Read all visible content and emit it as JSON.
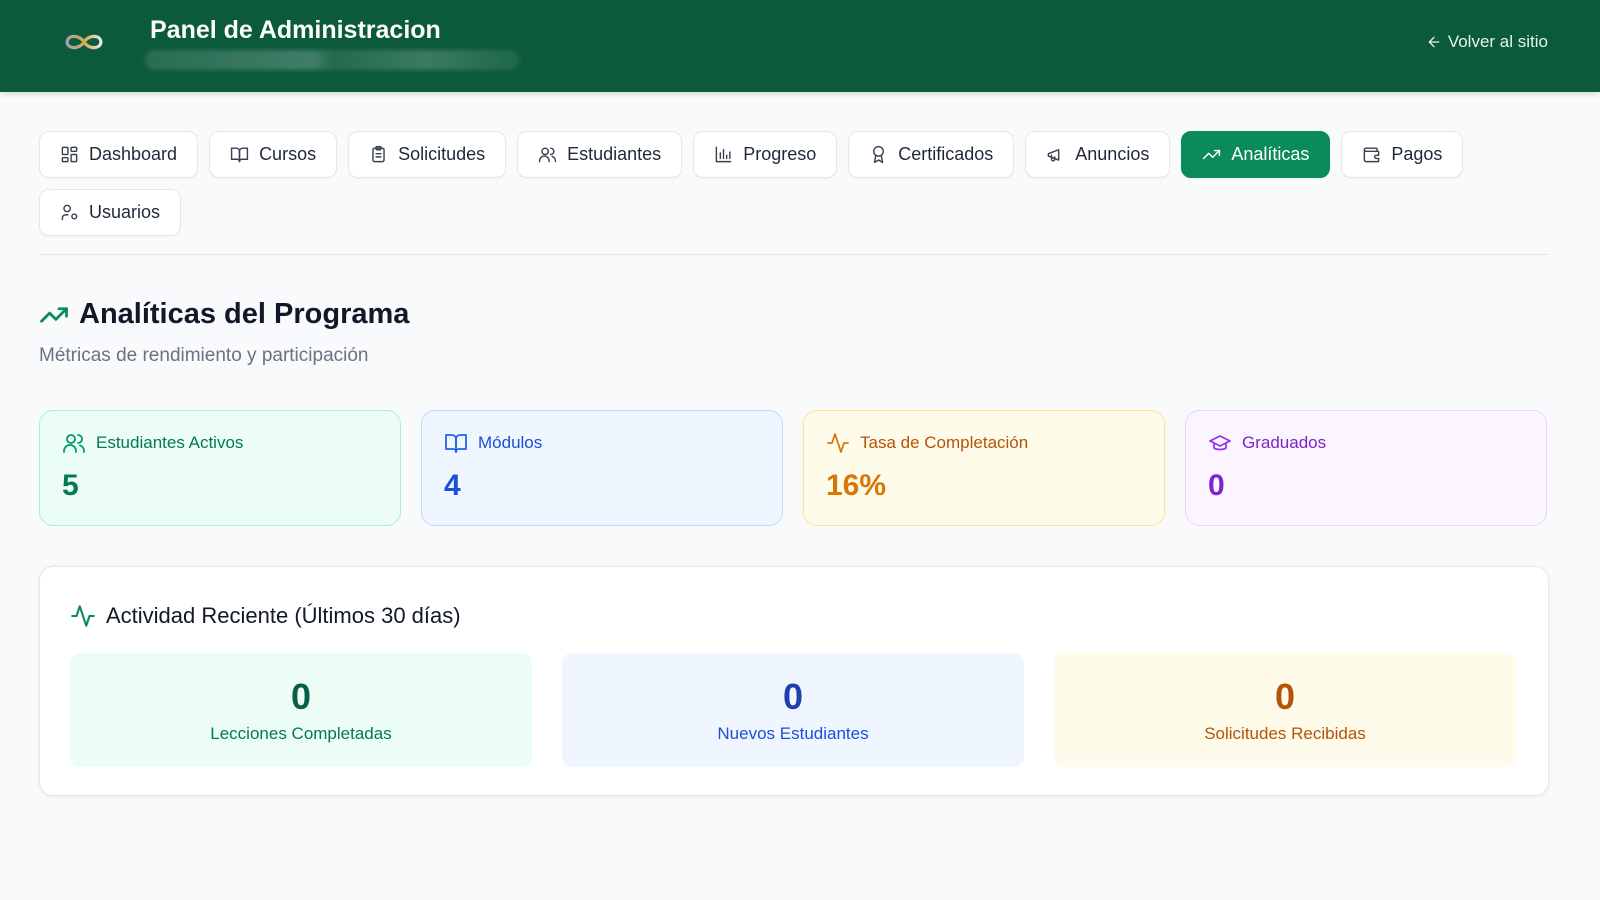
{
  "header": {
    "title": "Panel de Administracion",
    "back_link": "Volver al sitio"
  },
  "tabs": [
    {
      "label": "Dashboard",
      "icon": "layout-grid-icon"
    },
    {
      "label": "Cursos",
      "icon": "book-open-icon"
    },
    {
      "label": "Solicitudes",
      "icon": "clipboard-list-icon"
    },
    {
      "label": "Estudiantes",
      "icon": "users-icon"
    },
    {
      "label": "Progreso",
      "icon": "bar-chart-icon"
    },
    {
      "label": "Certificados",
      "icon": "award-icon"
    },
    {
      "label": "Anuncios",
      "icon": "megaphone-icon"
    },
    {
      "label": "Analíticas",
      "icon": "trending-up-icon",
      "active": true
    },
    {
      "label": "Pagos",
      "icon": "wallet-icon"
    },
    {
      "label": "Usuarios",
      "icon": "user-cog-icon"
    }
  ],
  "section": {
    "title": "Analíticas del Programa",
    "subtitle": "Métricas de rendimiento y participación"
  },
  "stats": [
    {
      "label": "Estudiantes Activos",
      "value": "5",
      "color": "#047857",
      "icon": "users-icon"
    },
    {
      "label": "Módulos",
      "value": "4",
      "color": "#1d4ed8",
      "icon": "book-open-icon"
    },
    {
      "label": "Tasa de Completación",
      "value": "16%",
      "color": "#d97706",
      "icon": "activity-icon"
    },
    {
      "label": "Graduados",
      "value": "0",
      "color": "#7e22ce",
      "icon": "graduation-cap-icon"
    }
  ],
  "activity": {
    "title": "Actividad Reciente (Últimos 30 días)",
    "items": [
      {
        "value": "0",
        "label": "Lecciones Completadas"
      },
      {
        "value": "0",
        "label": "Nuevos Estudiantes"
      },
      {
        "value": "0",
        "label": "Solicitudes Recibidas"
      }
    ]
  },
  "colors": {
    "header_bg": "#0b5a3c",
    "accent": "#0b8a5a"
  }
}
